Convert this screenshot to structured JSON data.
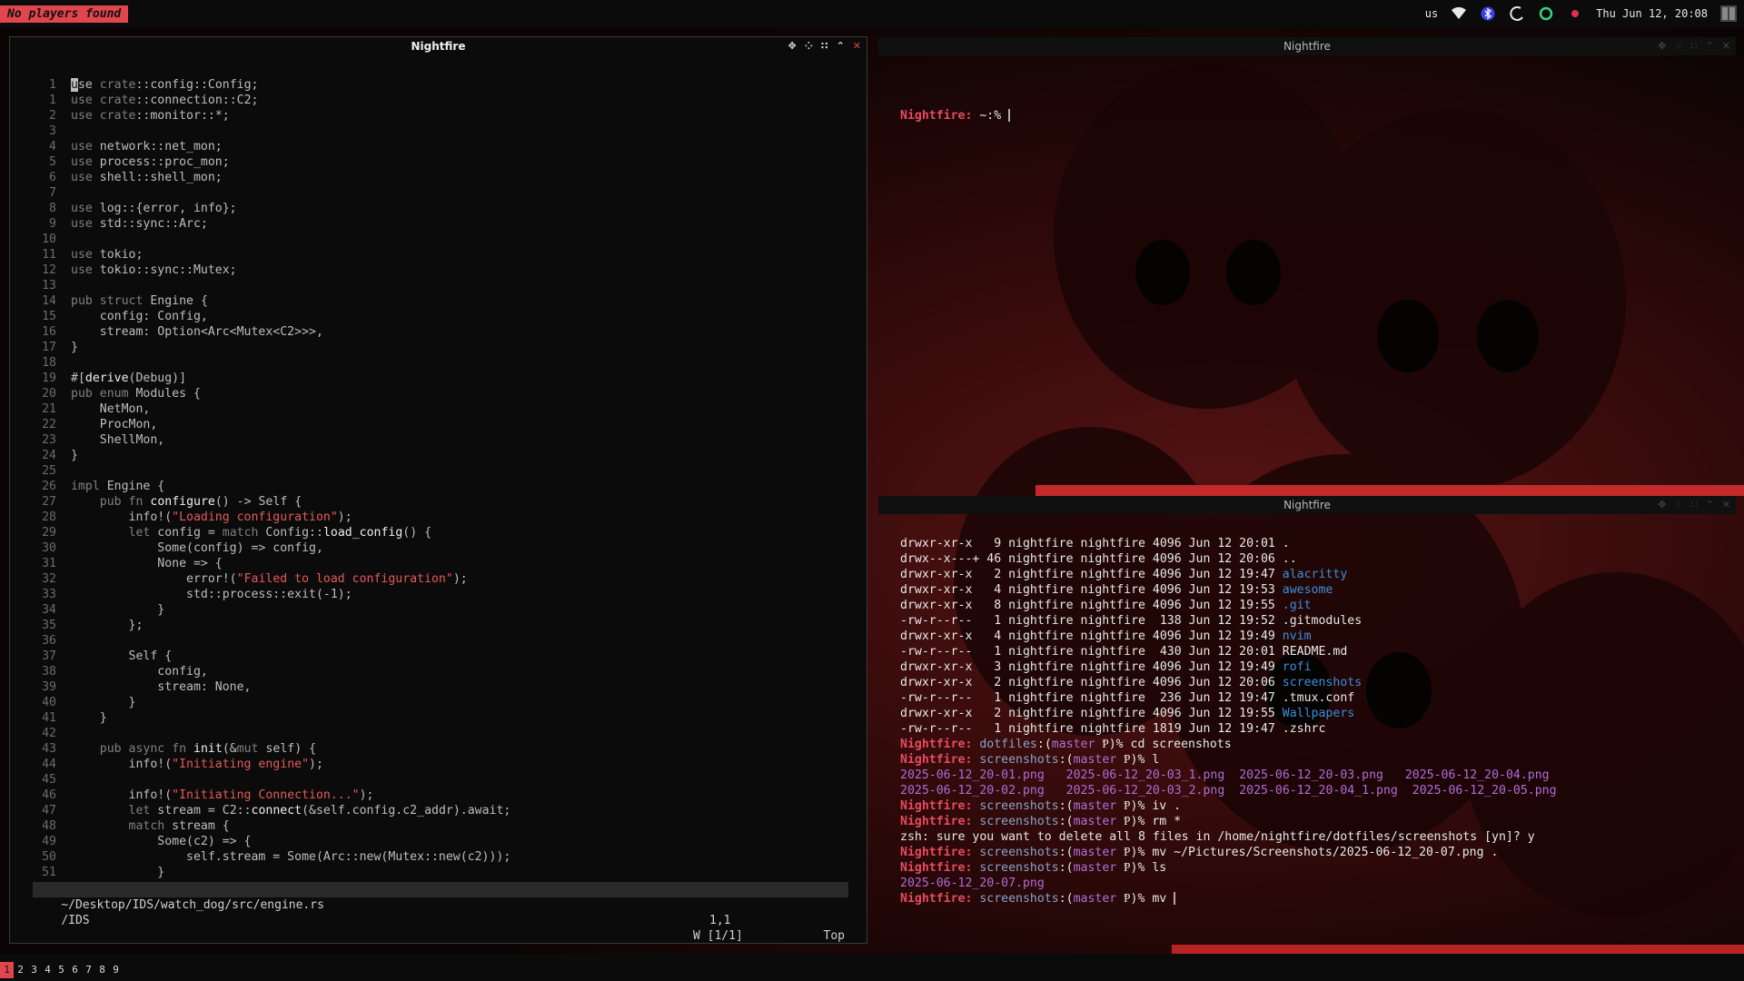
{
  "topbar": {
    "notice": "No players found",
    "keyboard_layout": "us",
    "clock": "Thu Jun 12, 20:08",
    "tray_icons": [
      "wifi-icon",
      "bluetooth-icon",
      "night-mode-icon",
      "status-ring-icon",
      "record-dot-icon",
      "layout-icon"
    ]
  },
  "editor": {
    "title": "Nightfire",
    "controls": [
      "float-icon",
      "sticky-icon",
      "ontop-icon",
      "maximize-icon",
      "close-icon"
    ],
    "line_numbers": [
      "1",
      "1",
      "2",
      "3",
      "4",
      "5",
      "6",
      "7",
      "8",
      "9",
      "10",
      "11",
      "12",
      "13",
      "14",
      "15",
      "16",
      "17",
      "18",
      "19",
      "20",
      "21",
      "22",
      "23",
      "24",
      "25",
      "26",
      "27",
      "28",
      "29",
      "30",
      "31",
      "32",
      "33",
      "34",
      "35",
      "36",
      "37",
      "38",
      "39",
      "40",
      "41",
      "42",
      "43",
      "44",
      "45",
      "46",
      "47",
      "48",
      "49",
      "50",
      "51"
    ],
    "code": [
      "use crate::config::Config;",
      "use crate::connection::C2;",
      "use crate::monitor::*;",
      "",
      "use network::net_mon;",
      "use process::proc_mon;",
      "use shell::shell_mon;",
      "",
      "use log::{error, info};",
      "use std::sync::Arc;",
      "",
      "use tokio;",
      "use tokio::sync::Mutex;",
      "",
      "pub struct Engine {",
      "    config: Config,",
      "    stream: Option<Arc<Mutex<C2>>>,",
      "}",
      "",
      "#[derive(Debug)]",
      "pub enum Modules {",
      "    NetMon,",
      "    ProcMon,",
      "    ShellMon,",
      "}",
      "",
      "impl Engine {",
      "    pub fn configure() -> Self {",
      "        info!(\"Loading configuration\");",
      "        let config = match Config::load_config() {",
      "            Some(config) => config,",
      "            None => {",
      "                error!(\"Failed to load configuration\");",
      "                std::process::exit(-1);",
      "            }",
      "        };",
      "",
      "        Self {",
      "            config,",
      "            stream: None,",
      "        }",
      "    }",
      "",
      "    pub async fn init(&mut self) {",
      "        info!(\"Initiating engine\");",
      "",
      "        info!(\"Initiating Connection...\");",
      "        let stream = C2::connect(&self.config.c2_addr).await;",
      "        match stream {",
      "            Some(c2) => {",
      "                self.stream = Some(Arc::new(Mutex::new(c2)));",
      "            }"
    ],
    "statusline": {
      "path": "~/Desktop/IDS/watch_dog/src/engine.rs",
      "position": "1,1",
      "scroll": "Top"
    },
    "cmdline": {
      "left": "/IDS",
      "right": "W [1/1]"
    }
  },
  "term_top": {
    "title": "Nightfire",
    "prompt_host": "Nightfire:",
    "prompt_path": " ~:% "
  },
  "term_bot": {
    "title": "Nightfire",
    "listing": [
      {
        "perm": "drwxr-xr-x ",
        "n": "  9",
        "user": "nightfire",
        "group": "nightfire",
        "size": "4096",
        "date": "Jun 12 20:01",
        "name": ".",
        "kind": "plain"
      },
      {
        "perm": "drwx--x---+",
        "n": " 46",
        "user": "nightfire",
        "group": "nightfire",
        "size": "4096",
        "date": "Jun 12 20:06",
        "name": "..",
        "kind": "plain"
      },
      {
        "perm": "drwxr-xr-x ",
        "n": "  2",
        "user": "nightfire",
        "group": "nightfire",
        "size": "4096",
        "date": "Jun 12 19:47",
        "name": "alacritty",
        "kind": "dir"
      },
      {
        "perm": "drwxr-xr-x ",
        "n": "  4",
        "user": "nightfire",
        "group": "nightfire",
        "size": "4096",
        "date": "Jun 12 19:53",
        "name": "awesome",
        "kind": "dir"
      },
      {
        "perm": "drwxr-xr-x ",
        "n": "  8",
        "user": "nightfire",
        "group": "nightfire",
        "size": "4096",
        "date": "Jun 12 19:55",
        "name": ".git",
        "kind": "dir"
      },
      {
        "perm": "-rw-r--r-- ",
        "n": "  1",
        "user": "nightfire",
        "group": "nightfire",
        "size": " 138",
        "date": "Jun 12 19:52",
        "name": ".gitmodules",
        "kind": "plain"
      },
      {
        "perm": "drwxr-xr-x ",
        "n": "  4",
        "user": "nightfire",
        "group": "nightfire",
        "size": "4096",
        "date": "Jun 12 19:49",
        "name": "nvim",
        "kind": "dir"
      },
      {
        "perm": "-rw-r--r-- ",
        "n": "  1",
        "user": "nightfire",
        "group": "nightfire",
        "size": " 430",
        "date": "Jun 12 20:01",
        "name": "README.md",
        "kind": "plain"
      },
      {
        "perm": "drwxr-xr-x ",
        "n": "  3",
        "user": "nightfire",
        "group": "nightfire",
        "size": "4096",
        "date": "Jun 12 19:49",
        "name": "rofi",
        "kind": "dir"
      },
      {
        "perm": "drwxr-xr-x ",
        "n": "  2",
        "user": "nightfire",
        "group": "nightfire",
        "size": "4096",
        "date": "Jun 12 20:06",
        "name": "screenshots",
        "kind": "dir"
      },
      {
        "perm": "-rw-r--r-- ",
        "n": "  1",
        "user": "nightfire",
        "group": "nightfire",
        "size": " 236",
        "date": "Jun 12 19:47",
        "name": ".tmux.conf",
        "kind": "plain"
      },
      {
        "perm": "drwxr-xr-x ",
        "n": "  2",
        "user": "nightfire",
        "group": "nightfire",
        "size": "4096",
        "date": "Jun 12 19:55",
        "name": "Wallpapers",
        "kind": "dir"
      },
      {
        "perm": "-rw-r--r-- ",
        "n": "  1",
        "user": "nightfire",
        "group": "nightfire",
        "size": "1819",
        "date": "Jun 12 19:47",
        "name": ".zshrc",
        "kind": "plain"
      }
    ],
    "session": [
      {
        "type": "prompt",
        "host": "Nightfire:",
        "dir": "dotfiles",
        "branch": "master",
        "cmd": "cd screenshots"
      },
      {
        "type": "prompt",
        "host": "Nightfire:",
        "dir": "screenshots",
        "branch": "master",
        "cmd": "l"
      },
      {
        "type": "files",
        "items": [
          "2025-06-12_20-01.png",
          "2025-06-12_20-03_1.png",
          "2025-06-12_20-03.png",
          "2025-06-12_20-04.png"
        ]
      },
      {
        "type": "files",
        "items": [
          "2025-06-12_20-02.png",
          "2025-06-12_20-03_2.png",
          "2025-06-12_20-04_1.png",
          "2025-06-12_20-05.png"
        ]
      },
      {
        "type": "prompt",
        "host": "Nightfire:",
        "dir": "screenshots",
        "branch": "master",
        "cmd": "iv ."
      },
      {
        "type": "prompt",
        "host": "Nightfire:",
        "dir": "screenshots",
        "branch": "master",
        "cmd": "rm *"
      },
      {
        "type": "text",
        "text": "zsh: sure you want to delete all 8 files in /home/nightfire/dotfiles/screenshots [yn]? y"
      },
      {
        "type": "prompt",
        "host": "Nightfire:",
        "dir": "screenshots",
        "branch": "master",
        "cmd": "mv ~/Pictures/Screenshots/2025-06-12_20-07.png ."
      },
      {
        "type": "prompt",
        "host": "Nightfire:",
        "dir": "screenshots",
        "branch": "master",
        "cmd": "ls"
      },
      {
        "type": "files",
        "items": [
          "2025-06-12_20-07.png"
        ]
      },
      {
        "type": "prompt",
        "host": "Nightfire:",
        "dir": "screenshots",
        "branch": "master",
        "cmd": "mv ",
        "cursor": true
      }
    ]
  },
  "tags": {
    "items": [
      "1",
      "2",
      "3",
      "4",
      "5",
      "6",
      "7",
      "8",
      "9"
    ],
    "active": "1"
  },
  "colors": {
    "accent": "#e0464c",
    "directory": "#3a8fd8",
    "png_file": "#b06cd8"
  }
}
